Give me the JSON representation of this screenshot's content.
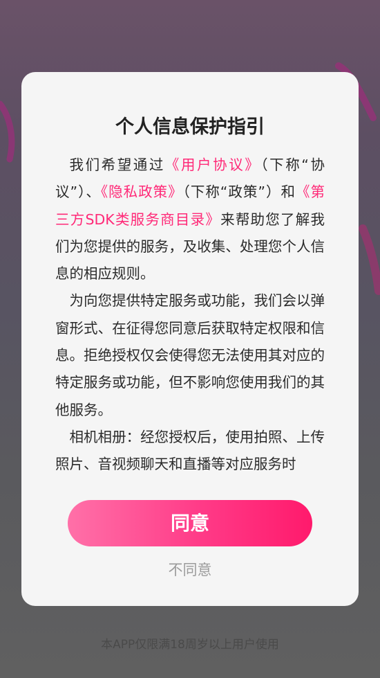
{
  "dialog": {
    "title": "个人信息保护指引",
    "para1": {
      "text_1": "我们希望通过",
      "link_user_agreement": "《用户协议》",
      "text_2": "（下称“协议”）、",
      "link_privacy_policy": "《隐私政策》",
      "text_3": "（下称“政策”）和",
      "link_sdk_list": "《第三方SDK类服务商目录》",
      "text_4": "来帮助您了解我们为您提供的服务，及收集、处理您个人信息的相应规则。"
    },
    "para2": "为向您提供特定服务或功能，我们会以弹窗形式、在征得您同意后获取特定权限和信息。拒绝授权仅会使得您无法使用其对应的特定服务或功能，但不影响您使用我们的其他服务。",
    "para3": "相机相册：经您授权后，使用拍照、上传照片、音视频聊天和直播等对应服务时",
    "agree_label": "同意",
    "disagree_label": "不同意"
  },
  "footer_note": "本APP仅限满18周岁以上用户使用",
  "colors": {
    "accent": "#ff2a78",
    "button_gradient_start": "#ff70a8",
    "button_gradient_end": "#ff1a6c",
    "dialog_bg": "#f5f5f5",
    "title_text": "#222222",
    "body_text": "#2b2b2b",
    "muted_text": "#9b9b9b"
  }
}
